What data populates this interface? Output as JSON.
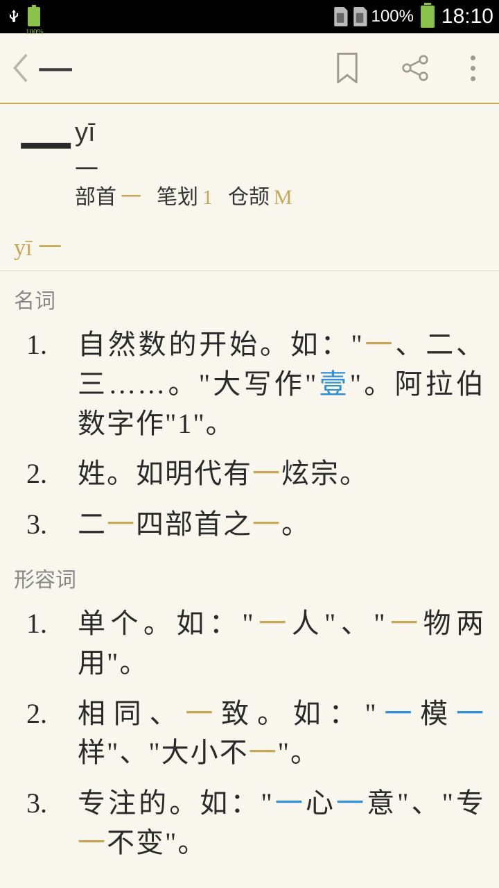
{
  "status": {
    "battery_pct": "100%",
    "battery_pct2": "100%",
    "time": "18:10"
  },
  "toolbar": {
    "title": "一"
  },
  "entry": {
    "char": "一",
    "pinyin": "yī",
    "char_small": "一",
    "radical_label": "部首",
    "radical_value": "一",
    "stroke_label": "笔划",
    "stroke_value": "1",
    "cangjie_label": "仓颉",
    "cangjie_value": "M"
  },
  "pron_line": "yī 一",
  "pos1": "名词",
  "pos2": "形容词",
  "noun": {
    "d1": {
      "p1": "自然数的开始。如：\"",
      "g1": "一",
      "p2": "、二、三……。\"大写作\"",
      "b1": "壹",
      "p3": "\"。阿拉伯数字作\"1\"。"
    },
    "d2": {
      "p1": "姓。如明代有",
      "g1": "一",
      "p2": "炫宗。"
    },
    "d3": {
      "p1": "二",
      "g1": "一",
      "p2": "四部首之",
      "g2": "一",
      "p3": "。"
    }
  },
  "adj": {
    "d1": {
      "p1": "单个。如：\"",
      "g1": "一",
      "p2": "人\"、\"",
      "g2": "一",
      "p3": "物两用\"。"
    },
    "d2": {
      "p1": "相同、",
      "g1": "一",
      "p2": "致。如：\"",
      "b1": "一",
      "p3": "模",
      "b2": "一",
      "p4": "样\"、\"大小不",
      "g2": "一",
      "p5": "\"。"
    },
    "d3": {
      "p1": "专注的。如：\"",
      "b1": "一",
      "p2": "心",
      "b2": "一",
      "p3": "意\"、\"专",
      "g1": "一",
      "p4": "不变\"。"
    }
  }
}
